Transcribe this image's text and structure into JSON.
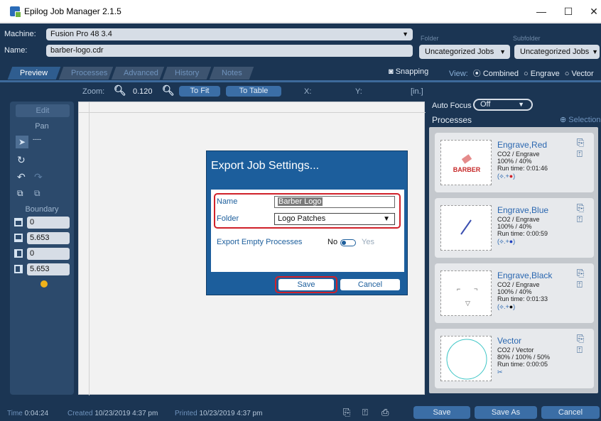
{
  "window": {
    "title": "Epilog Job Manager 2.1.5",
    "minimize": "—",
    "maximize": "☐",
    "close": "✕"
  },
  "header": {
    "machine_label": "Machine:",
    "machine_value": "Fusion Pro 48 3.4",
    "name_label": "Name:",
    "name_value": "barber-logo.cdr",
    "folder_label": "Folder",
    "folder_value": "Uncategorized Jobs",
    "subfolder_label": "Subfolder",
    "subfolder_value": "Uncategorized Jobs"
  },
  "tabs": [
    "Preview",
    "Processes",
    "Advanced",
    "History",
    "Notes"
  ],
  "snapping_label": "Snapping",
  "view": {
    "label": "View:",
    "options": [
      "Combined",
      "Engrave",
      "Vector"
    ],
    "selected": "Combined"
  },
  "zoom": {
    "label": "Zoom:",
    "value": "0.120",
    "to_fit": "To Fit",
    "to_table": "To Table",
    "x_label": "X:",
    "y_label": "Y:",
    "unit": "[in.]"
  },
  "tools": {
    "edit": "Edit",
    "pan": "Pan",
    "boundary": "Boundary",
    "boundary_values": [
      "0",
      "5.653",
      "0",
      "5.653"
    ]
  },
  "autofocus": {
    "label": "Auto Focus",
    "value": "Off"
  },
  "processes": {
    "title": "Processes",
    "selection": "Selection",
    "items": [
      {
        "name": "Engrave,Red",
        "type": "CO2 / Engrave",
        "power": "100% / 40%",
        "runtime": "Run time: 0:01:46",
        "thumb_text": "BARBER"
      },
      {
        "name": "Engrave,Blue",
        "type": "CO2 / Engrave",
        "power": "100% / 40%",
        "runtime": "Run time: 0:00:59",
        "thumb_text": ""
      },
      {
        "name": "Engrave,Black",
        "type": "CO2 / Engrave",
        "power": "100% / 40%",
        "runtime": "Run time: 0:01:33",
        "thumb_text": ""
      },
      {
        "name": "Vector",
        "type": "CO2 / Vector",
        "power": "80% / 100% / 50%",
        "runtime": "Run time: 0:00:05",
        "thumb_text": ""
      }
    ]
  },
  "status": {
    "time_label": "Time",
    "time_value": "0:04:24",
    "created_label": "Created",
    "created_value": "10/23/2019 4:37 pm",
    "printed_label": "Printed",
    "printed_value": "10/23/2019 4:37 pm",
    "save": "Save",
    "save_as": "Save As",
    "cancel": "Cancel"
  },
  "dialog": {
    "title": "Export Job Settings...",
    "name_label": "Name",
    "name_value": "Barber Logo",
    "folder_label": "Folder",
    "folder_value": "Logo Patches",
    "empty_label": "Export Empty Processes",
    "no": "No",
    "yes": "Yes",
    "save": "Save",
    "cancel": "Cancel"
  },
  "colors": {
    "app_bg": "#1b3553",
    "dialog_bg": "#1c5e9c",
    "highlight_red": "#d0212a",
    "accent_blue": "#3b6ea6"
  }
}
